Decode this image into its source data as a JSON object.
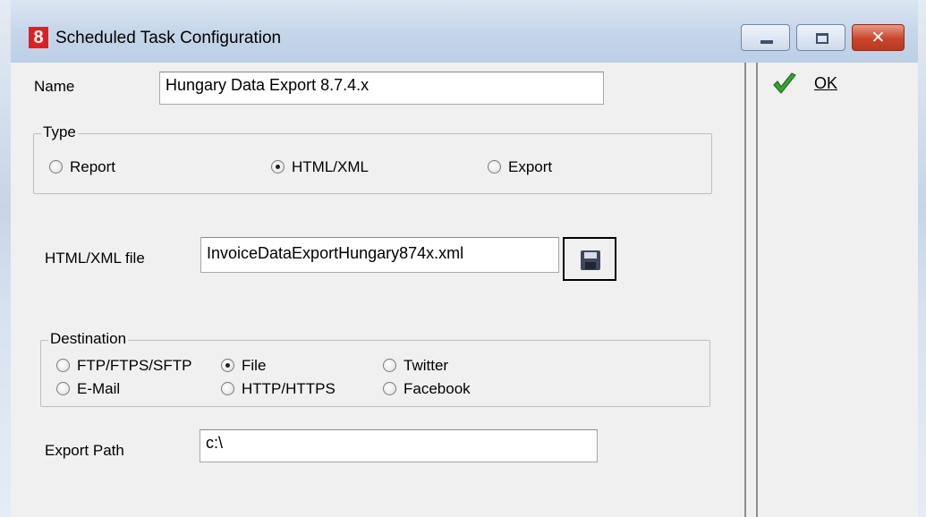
{
  "window": {
    "app_icon": "8",
    "title": "Scheduled Task Configuration",
    "close_glyph": "✕"
  },
  "toolbar": {
    "ok_label": "OK"
  },
  "form": {
    "name_label": "Name",
    "name_value": "Hungary Data Export 8.7.4.x",
    "type_legend": "Type",
    "type_options": [
      "Report",
      "HTML/XML",
      "Export"
    ],
    "type_selected": "HTML/XML",
    "file_label": "HTML/XML file",
    "file_value": "InvoiceDataExportHungary874x.xml",
    "destination_legend": "Destination",
    "destination_options": [
      "FTP/FTPS/SFTP",
      "File",
      "Twitter",
      "E-Mail",
      "HTTP/HTTPS",
      "Facebook"
    ],
    "destination_selected": "File",
    "export_path_label": "Export Path",
    "export_path_value": "c:\\"
  },
  "icons": {
    "app": "app-logo-icon",
    "ok": "checkmark-icon",
    "browse": "floppy-disk-icon"
  },
  "colors": {
    "app_icon_bg": "#e02020",
    "close_button": "#c9452c",
    "check_green": "#3aa031",
    "client_bg": "#f0f0f0"
  }
}
